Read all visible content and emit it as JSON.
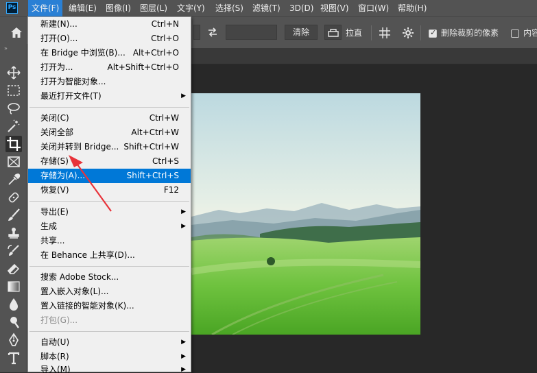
{
  "app": {
    "logo_text": "Ps"
  },
  "menubar": {
    "items": [
      {
        "label": "文件(F)"
      },
      {
        "label": "编辑(E)"
      },
      {
        "label": "图像(I)"
      },
      {
        "label": "图层(L)"
      },
      {
        "label": "文字(Y)"
      },
      {
        "label": "选择(S)"
      },
      {
        "label": "滤镜(T)"
      },
      {
        "label": "3D(D)"
      },
      {
        "label": "视图(V)"
      },
      {
        "label": "窗口(W)"
      },
      {
        "label": "帮助(H)"
      }
    ],
    "active_index": 0
  },
  "options_bar": {
    "clear_label": "清除",
    "straighten_label": "拉直",
    "delete_cropped_label": "删除裁剪的像素",
    "delete_cropped_checked": true,
    "content_aware_label": "内容",
    "content_aware_checked": false
  },
  "file_menu": {
    "items": [
      {
        "label": "新建(N)...",
        "shortcut": "Ctrl+N"
      },
      {
        "label": "打开(O)...",
        "shortcut": "Ctrl+O"
      },
      {
        "label": "在 Bridge 中浏览(B)...",
        "shortcut": "Alt+Ctrl+O"
      },
      {
        "label": "打开为...",
        "shortcut": "Alt+Shift+Ctrl+O"
      },
      {
        "label": "打开为智能对象...",
        "shortcut": ""
      },
      {
        "label": "最近打开文件(T)",
        "shortcut": "",
        "submenu": true
      },
      {
        "label": "关闭(C)",
        "shortcut": "Ctrl+W"
      },
      {
        "label": "关闭全部",
        "shortcut": "Alt+Ctrl+W"
      },
      {
        "label": "关闭并转到 Bridge...",
        "shortcut": "Shift+Ctrl+W"
      },
      {
        "label": "存储(S)",
        "shortcut": "Ctrl+S"
      },
      {
        "label": "存储为(A)...",
        "shortcut": "Shift+Ctrl+S",
        "highlighted": true
      },
      {
        "label": "恢复(V)",
        "shortcut": "F12"
      },
      {
        "label": "导出(E)",
        "shortcut": "",
        "submenu": true
      },
      {
        "label": "生成",
        "shortcut": "",
        "submenu": true
      },
      {
        "label": "共享...",
        "shortcut": ""
      },
      {
        "label": "在 Behance 上共享(D)...",
        "shortcut": ""
      },
      {
        "label": "搜索 Adobe Stock...",
        "shortcut": ""
      },
      {
        "label": "置入嵌入对象(L)...",
        "shortcut": ""
      },
      {
        "label": "置入链接的智能对象(K)...",
        "shortcut": ""
      },
      {
        "label": "打包(G)...",
        "shortcut": "",
        "disabled": true
      },
      {
        "label": "自动(U)",
        "shortcut": "",
        "submenu": true
      },
      {
        "label": "脚本(R)",
        "shortcut": "",
        "submenu": true
      },
      {
        "label": "导入(M)",
        "shortcut": "",
        "submenu": true
      }
    ]
  },
  "toolbar": {
    "tools": [
      {
        "icon": "move-icon"
      },
      {
        "icon": "marquee-icon"
      },
      {
        "icon": "lasso-icon"
      },
      {
        "icon": "magic-wand-icon"
      },
      {
        "icon": "crop-icon",
        "selected": true
      },
      {
        "icon": "frame-icon"
      },
      {
        "icon": "eyedropper-icon"
      },
      {
        "icon": "healing-brush-icon"
      },
      {
        "icon": "brush-icon"
      },
      {
        "icon": "clone-stamp-icon"
      },
      {
        "icon": "history-brush-icon"
      },
      {
        "icon": "eraser-icon"
      },
      {
        "icon": "gradient-icon"
      },
      {
        "icon": "blur-icon"
      },
      {
        "icon": "dodge-icon"
      },
      {
        "icon": "pen-icon"
      },
      {
        "icon": "type-icon"
      }
    ]
  },
  "colors": {
    "menu_highlight": "#0078d7",
    "annotation_arrow": "#e8333a"
  }
}
